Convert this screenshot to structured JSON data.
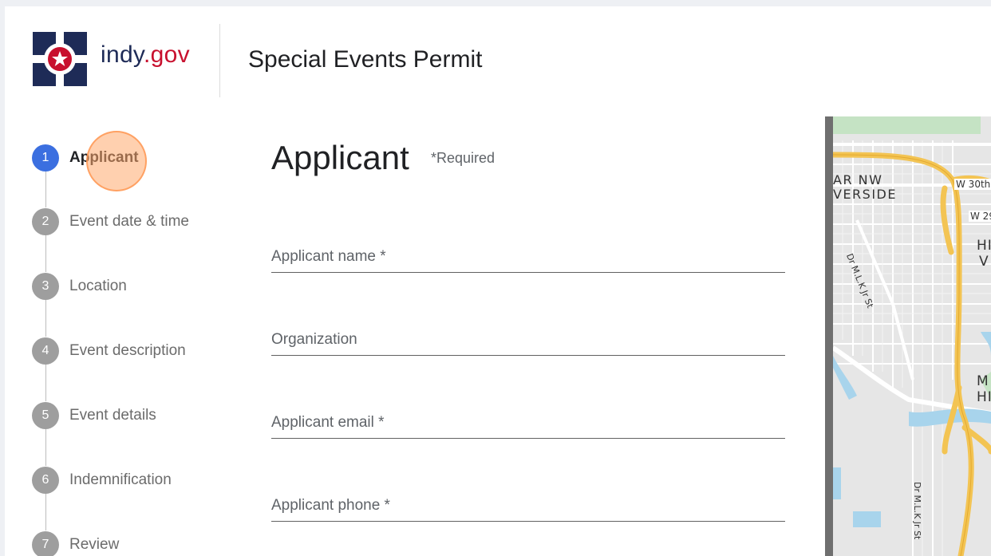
{
  "header": {
    "logo_name": "indy",
    "logo_dot": ".",
    "logo_tld": "gov",
    "title": "Special Events Permit"
  },
  "steps": [
    {
      "number": "1",
      "label": "Applicant",
      "active": true
    },
    {
      "number": "2",
      "label": "Event date & time",
      "active": false
    },
    {
      "number": "3",
      "label": "Location",
      "active": false
    },
    {
      "number": "4",
      "label": "Event description",
      "active": false
    },
    {
      "number": "5",
      "label": "Event details",
      "active": false
    },
    {
      "number": "6",
      "label": "Indemnification",
      "active": false
    },
    {
      "number": "7",
      "label": "Review",
      "active": false
    }
  ],
  "form": {
    "title": "Applicant",
    "required_note": "*Required",
    "fields": [
      {
        "label": "Applicant name *",
        "value": ""
      },
      {
        "label": "Organization",
        "value": ""
      },
      {
        "label": "Applicant email *",
        "value": ""
      },
      {
        "label": "Applicant phone *",
        "value": ""
      }
    ]
  },
  "map": {
    "labels": {
      "area1": "AR NW",
      "area2": "VERSIDE",
      "street_w30": "W 30th",
      "street_w29": "W 29",
      "mlk_top": "Dr M.L.K Jr St",
      "mlk_bottom": "Dr M.L.K Jr St",
      "hi1": "HI",
      "hi2": "V",
      "me1": "M",
      "me2": "HI"
    },
    "colors": {
      "highway": "#f3c453",
      "water": "#a8d4ec",
      "park": "#c5e3c4",
      "land": "#e6e6e6"
    }
  },
  "colors": {
    "active_step": "#3b6fe0",
    "inactive_step": "#9e9e9e",
    "brand_navy": "#1e2b57",
    "brand_red": "#c8102e"
  }
}
